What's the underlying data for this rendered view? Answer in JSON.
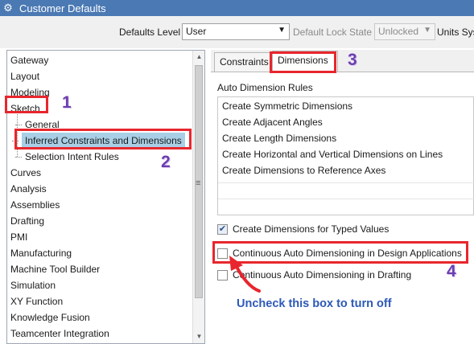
{
  "window": {
    "title": "Customer Defaults"
  },
  "toolbar": {
    "defaults_level_label": "Defaults Level",
    "defaults_level_value": "User",
    "lock_state_label": "Default Lock State",
    "lock_state_value": "Unlocked",
    "units_label": "Units Sys"
  },
  "tree": {
    "items": [
      "Gateway",
      "Layout",
      "Modeling",
      "Sketch",
      "General",
      "Inferred Constraints and Dimensions",
      "Selection Intent Rules",
      "Curves",
      "Analysis",
      "Assemblies",
      "Drafting",
      "PMI",
      "Manufacturing",
      "Machine Tool Builder",
      "Simulation",
      "XY Function",
      "Knowledge Fusion",
      "Teamcenter Integration"
    ],
    "selected": "Inferred Constraints and Dimensions"
  },
  "tabs": [
    "Constraints",
    "Dimensions"
  ],
  "active_tab": "Dimensions",
  "auto_dimension_rules": {
    "title": "Auto Dimension Rules",
    "rules": [
      "Create Symmetric Dimensions",
      "Create Adjacent Angles",
      "Create Length Dimensions",
      "Create Horizontal and Vertical Dimensions on Lines",
      "Create Dimensions to Reference Axes"
    ]
  },
  "options": [
    {
      "label": "Create Dimensions for Typed Values",
      "checked": true
    },
    {
      "label": "Continuous Auto Dimensioning in Design Applications",
      "checked": false
    },
    {
      "label": "Continuous Auto Dimensioning in Drafting",
      "checked": false
    }
  ],
  "annotations": {
    "step1": "1",
    "step2": "2",
    "step3": "3",
    "step4": "4",
    "callout": "Uncheck this box to turn off",
    "highlight_color": "#e8262d",
    "number_color": "#6c3eb0",
    "callout_color": "#2d59b8"
  },
  "colors": {
    "titlebar": "#4a79b3",
    "selection": "#a8cfe6"
  }
}
